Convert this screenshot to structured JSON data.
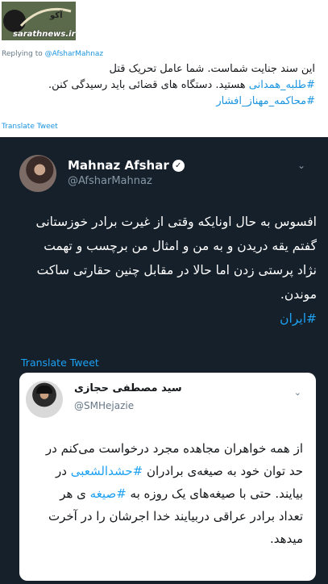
{
  "outer": {
    "logo_text": "sarathnews.ir",
    "logo_name": "آکو",
    "replying_prefix": "Replying to ",
    "replying_handle": "@AfsharMahnaz",
    "text_line1": "این سند جنایت شماست. شما عامل تحریک قتل",
    "text_tag1": "#طلبه_همدانی",
    "text_line2": " هستید. دستگاه های قضائی باید رسیدگی",
    "text_line3": "کنن. ",
    "text_tag2": "#محاکمه_مهناز_افشار",
    "translate": "Translate Tweet"
  },
  "tweet": {
    "name": "Mahnaz Afshar",
    "verified_icon": "✓",
    "handle": "@AfsharMahnaz",
    "chevron": "⌄",
    "text": "افسوس به حال اونایکه وقتی از غیرت برادر خوزستانی گفتم یقه دریدن و به من و امثال من برچسب و تهمت نژاد پرستی زدن اما حالا در مقابل چنین حقارتی ساکت موندن.",
    "tag": "#ایران",
    "translate": "Translate Tweet"
  },
  "quote": {
    "name": "سید مصطفی حجازی",
    "handle": "@SMHejazie",
    "chevron": "⌄",
    "text_part1": "از همه خواهران مجاهده مجرد درخواست می‌کنم در حد توان خود به صیغه‌ی برادران ",
    "tag1": "#حشدالشعبی",
    "text_part2": " در بیایند. حتی با صیغه‌های یک روزه به ",
    "tag2": "#صیغه",
    "text_part3": " ی هر تعداد برادر عراقی دربیایند خدا اجرشان را در آخرت میدهد."
  }
}
